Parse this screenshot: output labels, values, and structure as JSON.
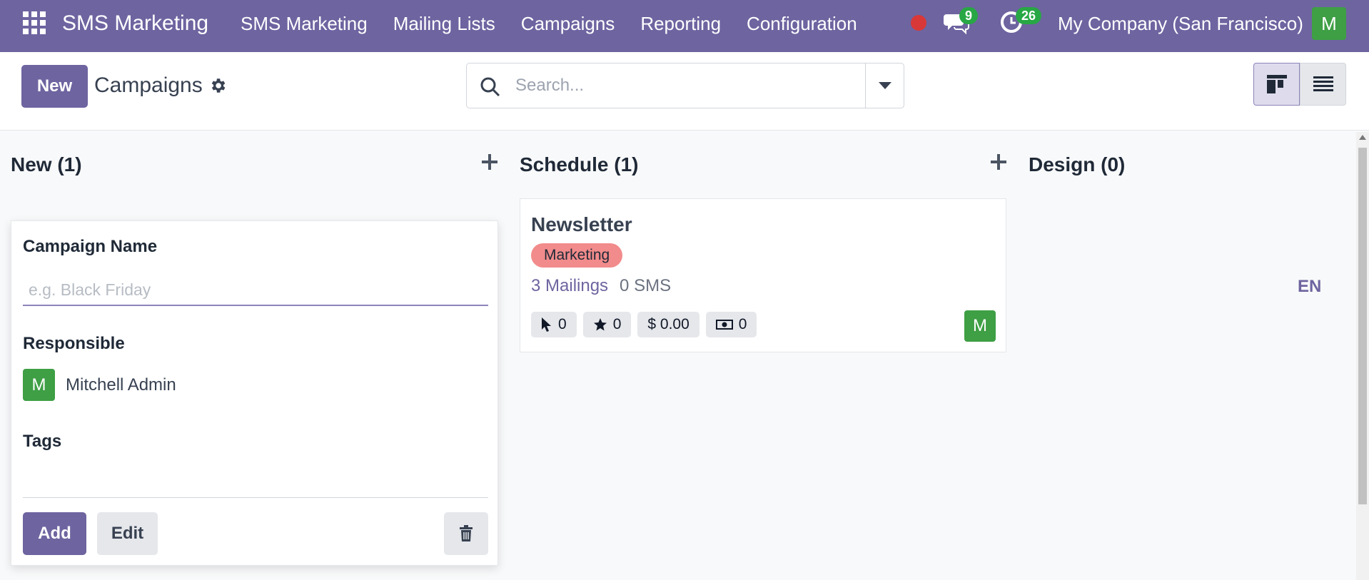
{
  "topbar": {
    "brand": "SMS Marketing",
    "menu": [
      "SMS Marketing",
      "Mailing Lists",
      "Campaigns",
      "Reporting",
      "Configuration"
    ],
    "messages_count": "9",
    "activities_count": "26",
    "company": "My Company (San Francisco)",
    "user_initial": "M"
  },
  "control": {
    "new_label": "New",
    "title": "Campaigns",
    "search_placeholder": "Search..."
  },
  "columns": [
    {
      "title": "New (1)"
    },
    {
      "title": "Schedule (1)"
    },
    {
      "title": "Design (0)"
    }
  ],
  "quick_create": {
    "name_label": "Campaign Name",
    "name_placeholder": "e.g. Black Friday",
    "responsible_label": "Responsible",
    "responsible_initial": "M",
    "responsible_name": "Mitchell Admin",
    "tags_label": "Tags",
    "add_label": "Add",
    "edit_label": "Edit"
  },
  "card": {
    "title": "Newsletter",
    "tag": "Marketing",
    "mailings": "3 Mailings",
    "sms": "0 SMS",
    "clicks": "0",
    "favorites": "0",
    "revenue": "$ 0.00",
    "cost": "0",
    "avatar_initial": "M"
  },
  "lang": "EN",
  "colors": {
    "brand": "#6e64a0",
    "avatar": "#3e9f44",
    "badge": "#28a745",
    "tag": "#f28b8b"
  }
}
